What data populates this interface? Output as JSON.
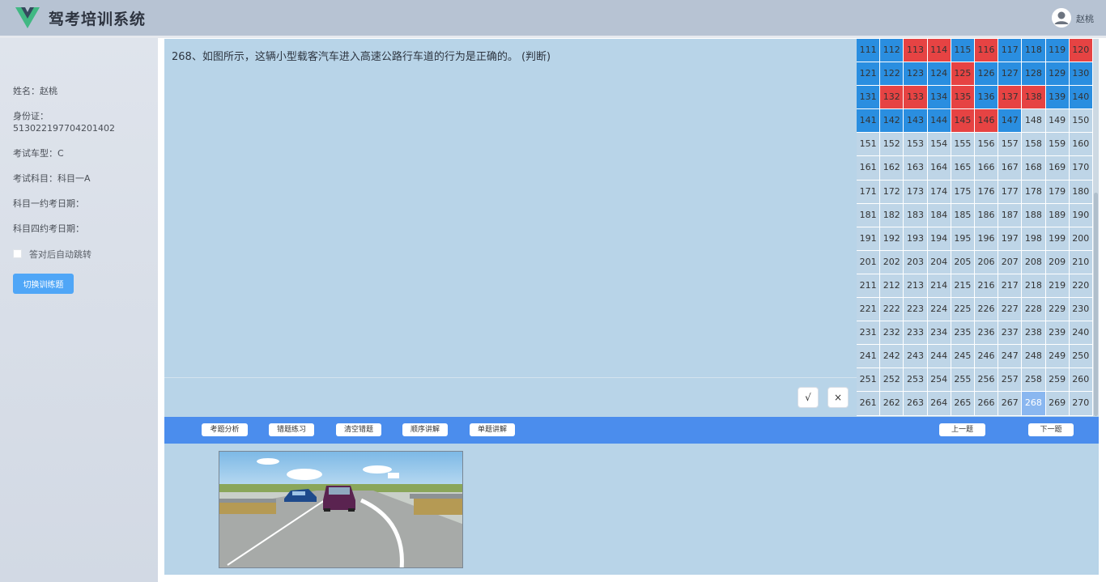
{
  "header": {
    "app_title": "驾考培训系统",
    "user_name": "赵桃"
  },
  "sidebar": {
    "name": "姓名：赵桃",
    "id_label": "身份证：",
    "id_value": "513022197704201402",
    "car_type": "考试车型：C",
    "subject": "考试科目：科目一A",
    "subject1_date": "科目一约考日期：",
    "subject4_date": "科目四约考日期：",
    "auto_jump_label": "答对后自动跳转",
    "switch_button": "切换训练题"
  },
  "question": {
    "text": "268、如图所示，这辆小型载客汽车进入高速公路行车道的行为是正确的。 (判断)",
    "true_label": "√",
    "false_label": "×"
  },
  "toolbar": {
    "analysis": "考题分析",
    "wrong_practice": "错题练习",
    "clear_wrong": "清空错题",
    "sequential": "顺序讲解",
    "single": "单题讲解",
    "prev": "上一题",
    "next": "下一题"
  },
  "colors": {
    "correct": "#2a8ee0",
    "wrong": "#e64343",
    "current": "#8ab7f0",
    "toolbar": "#4b8ded"
  },
  "grid": {
    "first": 111,
    "last": 270,
    "current": 268,
    "wrong": [
      113,
      114,
      116,
      120,
      125,
      132,
      133,
      135,
      137,
      138,
      145,
      146
    ],
    "correct": [
      111,
      112,
      115,
      117,
      118,
      119,
      121,
      122,
      123,
      124,
      126,
      127,
      128,
      129,
      130,
      131,
      134,
      136,
      139,
      140,
      141,
      142,
      143,
      144,
      147
    ]
  }
}
